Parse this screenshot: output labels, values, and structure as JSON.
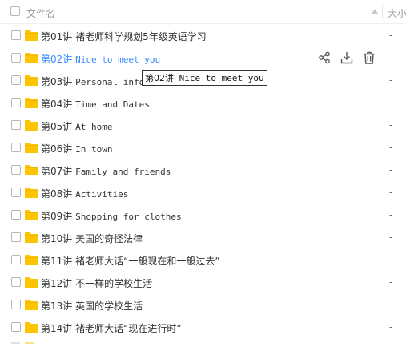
{
  "header": {
    "name_label": "文件名",
    "size_label": "大小"
  },
  "rows": [
    {
      "prefix": "第01讲",
      "title": "褚老师科学规划5年级英语学习",
      "mono": false,
      "size": "-"
    },
    {
      "prefix": "第02讲",
      "title": "Nice to meet you",
      "mono": true,
      "size": "-"
    },
    {
      "prefix": "第03讲",
      "title": "Personal infor",
      "mono": true,
      "size": "-"
    },
    {
      "prefix": "第04讲",
      "title": "Time and Dates",
      "mono": true,
      "size": "-"
    },
    {
      "prefix": "第05讲",
      "title": "At home",
      "mono": true,
      "size": "-"
    },
    {
      "prefix": "第06讲",
      "title": "In town",
      "mono": true,
      "size": "-"
    },
    {
      "prefix": "第07讲",
      "title": "Family and friends",
      "mono": true,
      "size": "-"
    },
    {
      "prefix": "第08讲",
      "title": "Activities",
      "mono": true,
      "size": "-"
    },
    {
      "prefix": "第09讲",
      "title": "Shopping for clothes",
      "mono": true,
      "size": "-"
    },
    {
      "prefix": "第10讲",
      "title": "美国的奇怪法律",
      "mono": false,
      "size": "-"
    },
    {
      "prefix": "第11讲",
      "title": "褚老师大话“一般现在和一般过去”",
      "mono": false,
      "size": "-"
    },
    {
      "prefix": "第12讲",
      "title": "不一样的学校生活",
      "mono": false,
      "size": "-"
    },
    {
      "prefix": "第13讲",
      "title": "英国的学校生活",
      "mono": false,
      "size": "-"
    },
    {
      "prefix": "第14讲",
      "title": "褚老师大话“现在进行时”",
      "mono": false,
      "size": "-"
    }
  ],
  "hovered_row": 1,
  "tooltip": {
    "prefix": "第02讲",
    "text": "Nice to meet you"
  },
  "row_actions": [
    "share-icon",
    "download-icon",
    "delete-icon"
  ],
  "colors": {
    "folder": "#ffc400",
    "folder_tab": "#f5b400",
    "hover_text": "#3b8cff",
    "icon": "#555555"
  }
}
